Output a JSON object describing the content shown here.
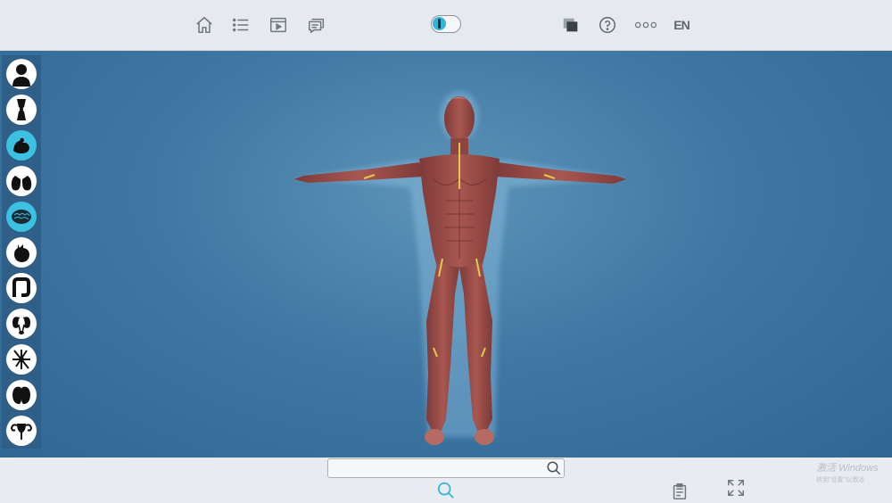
{
  "toolbar": {
    "buttons": [
      {
        "icon": "home-icon"
      },
      {
        "icon": "list-icon"
      },
      {
        "icon": "video-icon"
      },
      {
        "icon": "chat-icon"
      },
      {
        "icon": "layers-icon"
      },
      {
        "icon": "help-icon"
      },
      {
        "icon": "options-icon"
      }
    ],
    "language_label": "EN",
    "toggle": {
      "icon": "skeleton-toggle-icon"
    }
  },
  "sidebar": {
    "items": [
      {
        "icon": "skin-system-icon",
        "active": false
      },
      {
        "icon": "skeletal-system-icon",
        "active": false
      },
      {
        "icon": "muscular-system-icon",
        "active": true
      },
      {
        "icon": "respiratory-system-icon",
        "active": false
      },
      {
        "icon": "nervous-system-icon",
        "active": true
      },
      {
        "icon": "cardiovascular-system-icon",
        "active": false
      },
      {
        "icon": "digestive-system-icon",
        "active": false
      },
      {
        "icon": "urinary-system-icon",
        "active": false
      },
      {
        "icon": "lymphatic-system-icon",
        "active": false
      },
      {
        "icon": "endocrine-system-icon",
        "active": false
      },
      {
        "icon": "reproductive-system-icon",
        "active": false
      }
    ]
  },
  "search": {
    "value": "",
    "placeholder": ""
  },
  "colors": {
    "accent": "#3cc1e3",
    "viewport_top": "#5d93b8",
    "viewport_bottom": "#2f6795",
    "muscle": "#9b4a45",
    "nerve": "#e0c84a",
    "sidebar": "#2f5f86"
  },
  "watermark": {
    "line1": "激活 Windows",
    "line2": "转到\"设置\"以激活"
  }
}
